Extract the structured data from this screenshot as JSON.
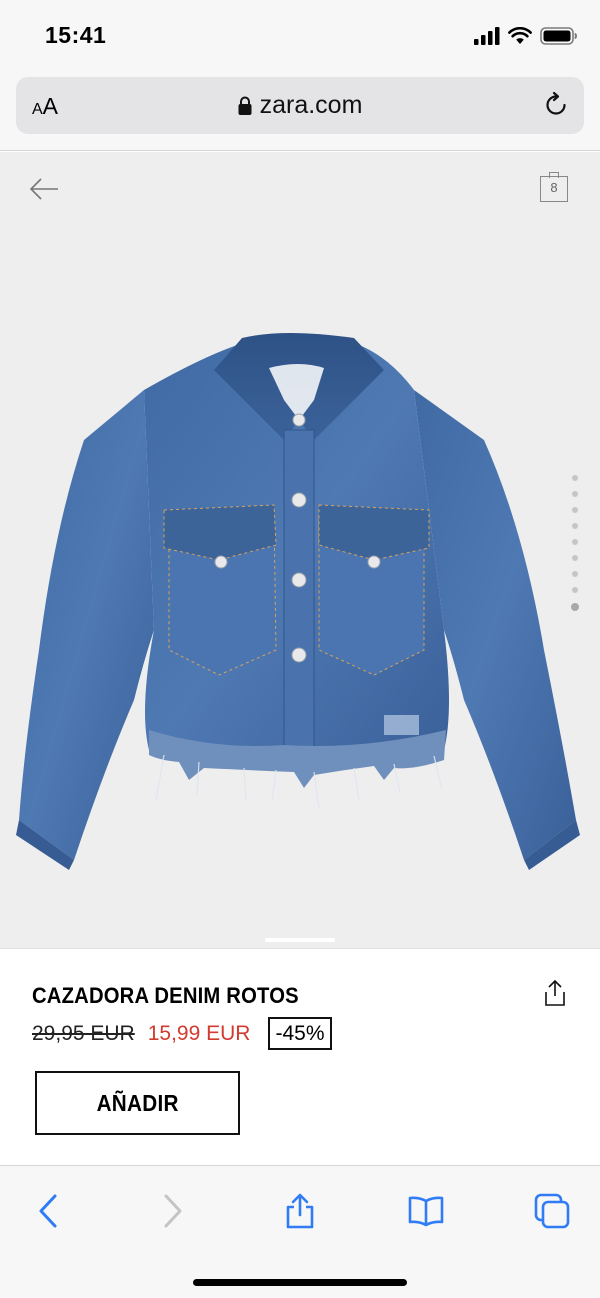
{
  "status_bar": {
    "time": "15:41"
  },
  "browser": {
    "text_size_label_small": "A",
    "text_size_label_large": "A",
    "url": "zara.com",
    "icons": [
      "lock-icon",
      "reload-icon"
    ]
  },
  "product_view": {
    "icons": [
      "back-arrow-icon",
      "shopping-bag-icon"
    ],
    "bag_count": "8",
    "image_count": 9,
    "active_image_index": 8
  },
  "product": {
    "name": "CAZADORA DENIM ROTOS",
    "old_price": "29,95 EUR",
    "new_price": "15,99 EUR",
    "discount": "-45%",
    "add_button_label": "AÑADIR"
  },
  "colors": {
    "sale_red": "#d23b2f",
    "ios_blue": "#2f7cf6",
    "image_background": "#eeeeee"
  },
  "toolbar": {
    "icons": [
      "back-chevron-icon",
      "forward-chevron-icon",
      "share-icon",
      "bookmarks-icon",
      "tabs-icon"
    ]
  }
}
